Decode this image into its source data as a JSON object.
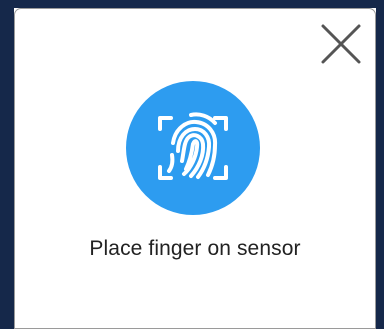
{
  "dialog": {
    "prompt": "Place finger on sensor",
    "close_icon": "close-icon",
    "fingerprint_icon": "fingerprint-scan-icon"
  },
  "colors": {
    "backdrop": "#15284a",
    "accent": "#2d9cf0",
    "icon_stroke": "#ffffff",
    "close_stroke": "#555555",
    "text": "#222222"
  }
}
